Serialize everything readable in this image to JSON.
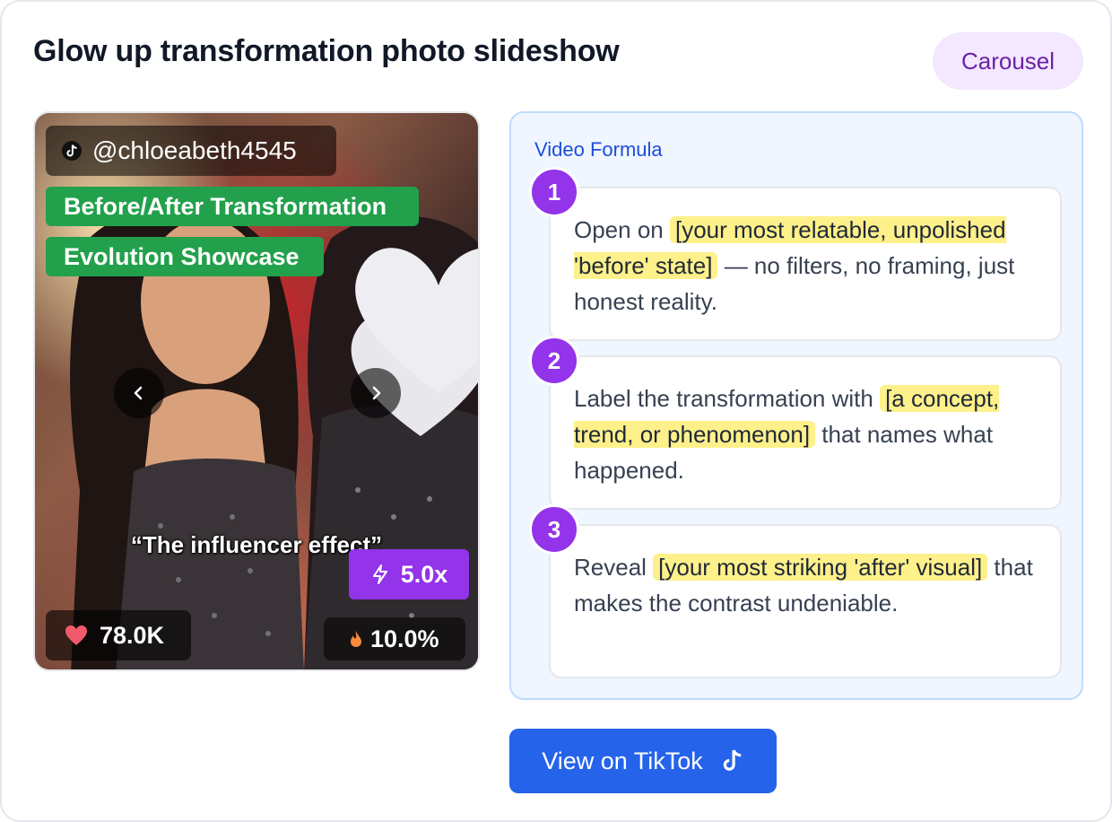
{
  "card": {
    "title": "Glow up transformation photo slideshow",
    "format_badge": "Carousel"
  },
  "media": {
    "handle": "@chloeabeth4545",
    "tags": [
      "Before/After Transformation",
      "Evolution Showcase"
    ],
    "caption": "“The influencer effect”",
    "multiplier": "5.0x",
    "likes": "78.0K",
    "engagement_rate": "10.0%",
    "icons": {
      "handle": "tiktok-icon",
      "prev": "chevron-left-icon",
      "next": "chevron-right-icon",
      "multiplier": "lightning-icon",
      "likes": "heart-icon",
      "rate": "flame-icon"
    }
  },
  "formula": {
    "label": "Video Formula",
    "steps": [
      {
        "number": "1",
        "parts": [
          "Open on ",
          "[your most relatable, unpolished 'before' state]",
          " — no filters, no framing, just honest reality."
        ]
      },
      {
        "number": "2",
        "parts": [
          "Label the transformation with ",
          "[a concept, trend, or phenomenon]",
          " that names what happened."
        ]
      },
      {
        "number": "3",
        "parts": [
          "Reveal ",
          "[your most striking 'after' visual]",
          " that makes the contrast undeniable."
        ]
      }
    ]
  },
  "cta": {
    "label": "View on TikTok",
    "icon": "tiktok-icon"
  },
  "colors": {
    "accent_purple": "#9333ea",
    "tag_green": "#22a04b",
    "button_blue": "#2563eb",
    "highlight_yellow": "#fef08a",
    "formula_bg": "#eff6ff"
  }
}
